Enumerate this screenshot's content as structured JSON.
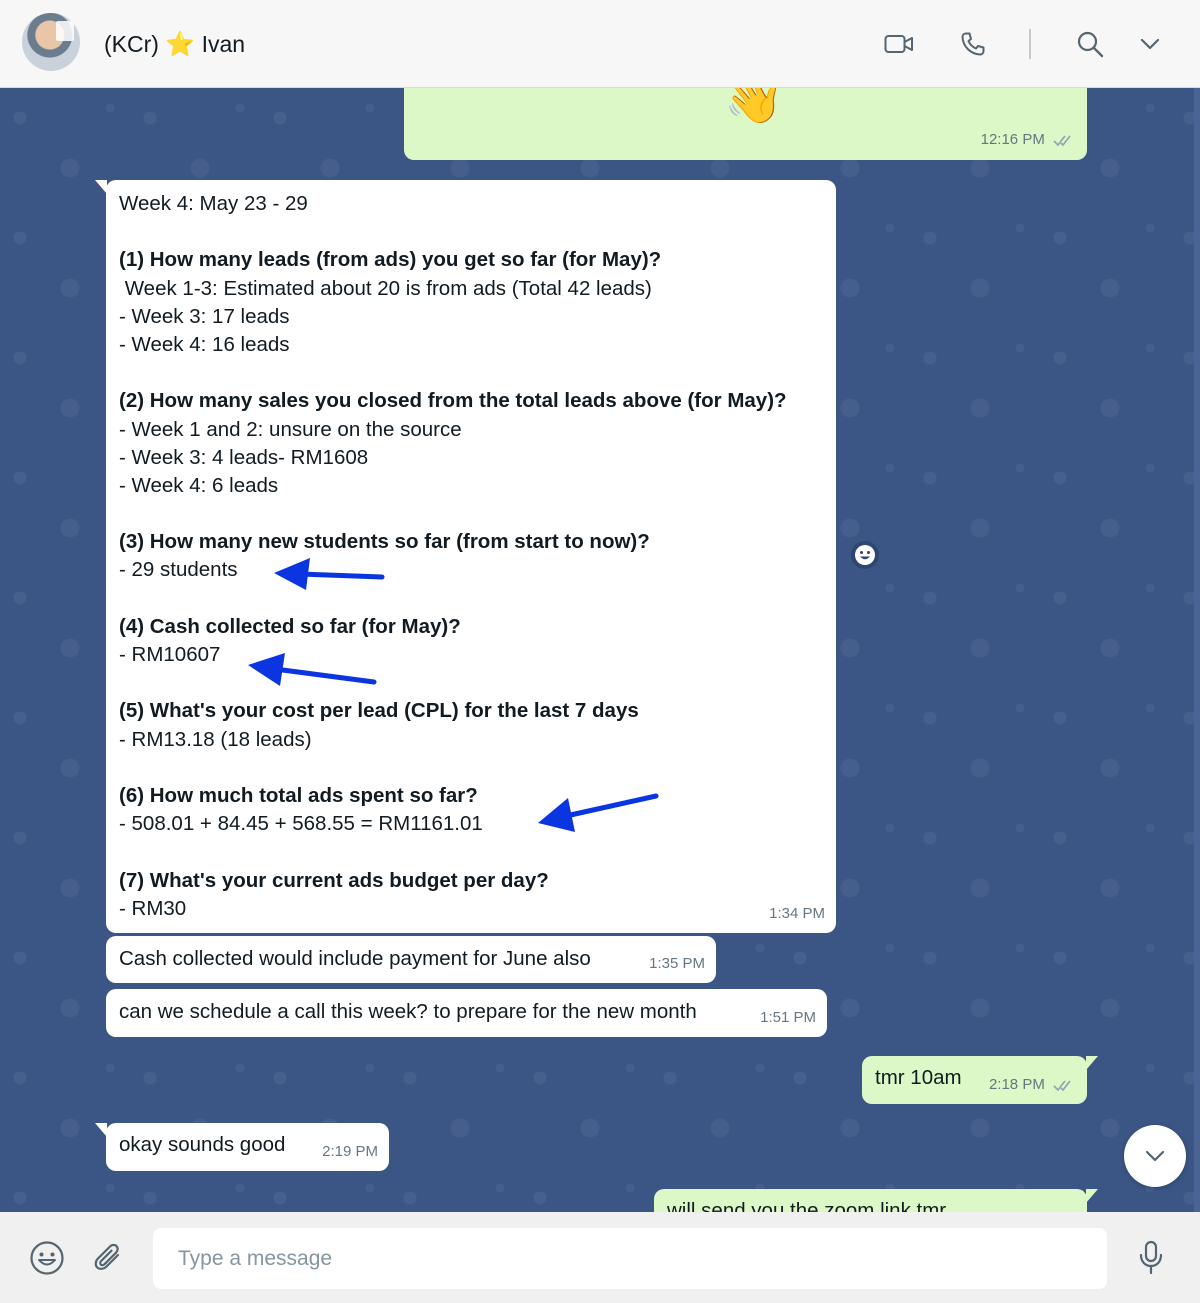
{
  "header": {
    "contact_prefix": "(KCr)",
    "contact_star": "⭐",
    "contact_name": "Ivan",
    "icons": [
      "video-call-icon",
      "voice-call-icon",
      "search-icon",
      "chevron-down-icon"
    ]
  },
  "messages": [
    {
      "direction": "outgoing",
      "content": "👋",
      "time": "12:16 PM",
      "status": "read"
    },
    {
      "direction": "incoming",
      "time": "1:34 PM",
      "lines": [
        {
          "text": "Week 4: May 23 - 29",
          "bold": false
        },
        {
          "text": "",
          "bold": false
        },
        {
          "text": "(1) How many leads (from ads) you get so far (for May)?",
          "bold": true
        },
        {
          "text": " Week 1-3: Estimated about 20 is from ads (Total 42 leads)",
          "bold": false
        },
        {
          "text": "- Week 3: 17 leads",
          "bold": false
        },
        {
          "text": "- Week 4: 16 leads",
          "bold": false
        },
        {
          "text": "",
          "bold": false
        },
        {
          "text": "(2) How many sales you closed from the total leads above (for May)?",
          "bold": true
        },
        {
          "text": "- Week 1 and 2: unsure on the source",
          "bold": false
        },
        {
          "text": "- Week 3: 4 leads- RM1608",
          "bold": false
        },
        {
          "text": "- Week 4: 6 leads",
          "bold": false
        },
        {
          "text": "",
          "bold": false
        },
        {
          "text": "(3) How many new students so far (from start to now)?",
          "bold": true
        },
        {
          "text": "- 29 students",
          "bold": false
        },
        {
          "text": "",
          "bold": false
        },
        {
          "text": "(4) Cash collected so far (for May)?",
          "bold": true
        },
        {
          "text": "- RM10607",
          "bold": false
        },
        {
          "text": "",
          "bold": false
        },
        {
          "text": "(5) What's your cost per lead (CPL) for the last 7 days",
          "bold": true
        },
        {
          "text": "- RM13.18 (18 leads)",
          "bold": false
        },
        {
          "text": "",
          "bold": false
        },
        {
          "text": "(6) How much total ads spent so far?",
          "bold": true
        },
        {
          "text": "- 508.01 + 84.45 + 568.55 = RM1161.01",
          "bold": false
        },
        {
          "text": "",
          "bold": false
        },
        {
          "text": "(7) What's your current ads budget per day?",
          "bold": true
        },
        {
          "text": "- RM30",
          "bold": false
        }
      ]
    },
    {
      "direction": "incoming",
      "text": "Cash collected would include payment for June also",
      "time": "1:35 PM"
    },
    {
      "direction": "incoming",
      "text": "can we schedule a call this week? to prepare for the new month",
      "time": "1:51 PM"
    },
    {
      "direction": "outgoing",
      "text": "tmr 10am",
      "time": "2:18 PM",
      "status": "read"
    },
    {
      "direction": "incoming",
      "text": "okay sounds good",
      "time": "2:19 PM"
    },
    {
      "direction": "outgoing",
      "text": "will send you the zoom link tmr",
      "time": ""
    }
  ],
  "annotations": {
    "arrow_color": "#0a35e0",
    "count": 3
  },
  "composer": {
    "placeholder": "Type a message",
    "icons": [
      "emoji-icon",
      "attach-icon",
      "microphone-icon"
    ]
  },
  "colors": {
    "chat_background": "#3b5585",
    "incoming_bubble": "#ffffff",
    "outgoing_bubble": "#dcf8c6",
    "timestamp": "#667781",
    "read_ticks": "#8fa3b3"
  }
}
